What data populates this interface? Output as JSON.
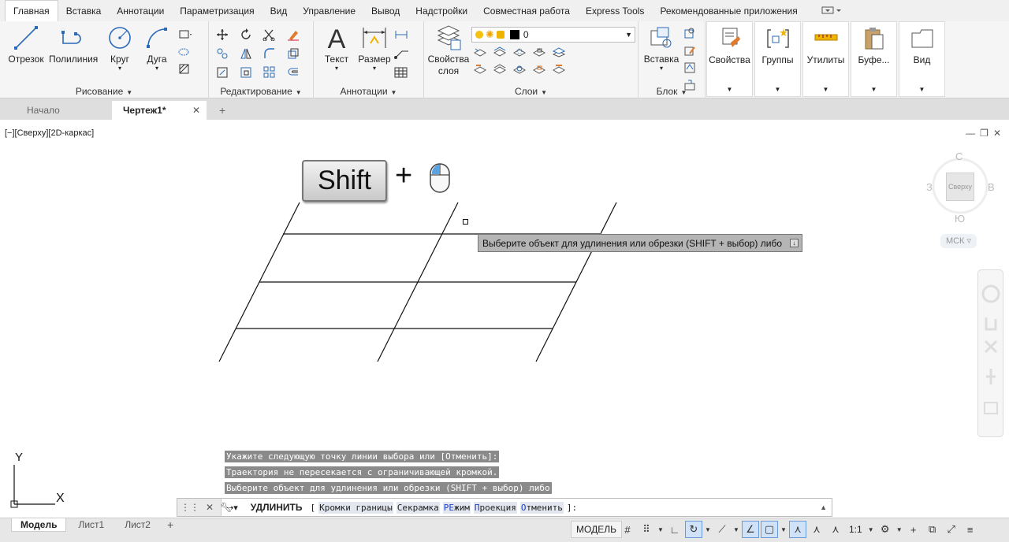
{
  "ribbon_tabs": [
    {
      "label": "Главная",
      "active": true
    },
    {
      "label": "Вставка"
    },
    {
      "label": "Аннотации"
    },
    {
      "label": "Параметризация"
    },
    {
      "label": "Вид"
    },
    {
      "label": "Управление"
    },
    {
      "label": "Вывод"
    },
    {
      "label": "Надстройки"
    },
    {
      "label": "Совместная работа"
    },
    {
      "label": "Express Tools"
    },
    {
      "label": "Рекомендованные приложения"
    }
  ],
  "ribbon": {
    "draw": {
      "title": "Рисование",
      "line": "Отрезок",
      "polyline": "Полилиния",
      "circle": "Круг",
      "arc": "Дуга"
    },
    "modify": {
      "title": "Редактирование"
    },
    "annotation": {
      "title": "Аннотации",
      "text": "Текст",
      "dimension": "Размер"
    },
    "layers": {
      "title": "Слои",
      "properties_l1": "Свойства",
      "properties_l2": "слоя",
      "current_layer": "0"
    },
    "block": {
      "title": "Блок",
      "insert": "Вставка"
    },
    "properties": "Свойства",
    "groups": "Группы",
    "utilities": "Утилиты",
    "clipboard": "Буфе...",
    "view": "Вид"
  },
  "doc_tabs": [
    {
      "label": "Начало"
    },
    {
      "label": "Чертеж1*",
      "active": true
    }
  ],
  "viewport": {
    "label": "[−][Сверху][2D-каркас]",
    "key_label": "Shift",
    "plus": "+",
    "tooltip": "Выберите объект для удлинения или обрезки (SHIFT + выбор) либо",
    "viewcube": {
      "north": "С",
      "south": "Ю",
      "west": "З",
      "east": "В",
      "face": "Сверху",
      "ucs": "МСК"
    },
    "ucs_x": "X",
    "ucs_y": "Y"
  },
  "command_history": [
    "Укажите следующую точку линии выбора или [Отменить]:",
    "Траектория не пересекается с ограничивающей кромкой.",
    "Выберите объект для удлинения или обрезки (SHIFT + выбор) либо"
  ],
  "command_line": {
    "command": "УДЛИНИТЬ",
    "open_bracket": "[",
    "options": [
      {
        "key": "",
        "rest": "Кромки границы"
      },
      {
        "key": "",
        "rest": "Секрамка"
      },
      {
        "key": "РЕ",
        "rest": "жим"
      },
      {
        "key": "П",
        "rest": "роекция"
      },
      {
        "key": "О",
        "rest": "тменить"
      }
    ],
    "close": "]:"
  },
  "layout_tabs": [
    {
      "label": "Модель",
      "active": true
    },
    {
      "label": "Лист1"
    },
    {
      "label": "Лист2"
    }
  ],
  "status": {
    "model": "МОДЕЛЬ",
    "scale": "1:1"
  }
}
